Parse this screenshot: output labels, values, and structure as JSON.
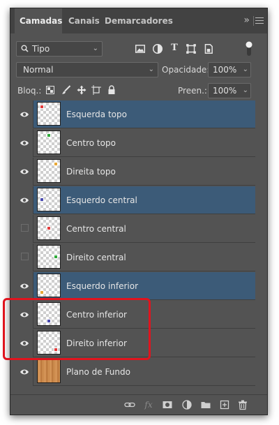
{
  "tabs": [
    {
      "label": "Camadas",
      "active": true
    },
    {
      "label": "Canais",
      "active": false
    },
    {
      "label": "Demarcadores",
      "active": false
    }
  ],
  "filter": {
    "value": "Tipo",
    "icon": "search-icon"
  },
  "filter_icons": [
    "image-filter-icon",
    "adjustment-filter-icon",
    "type-filter-icon",
    "shape-filter-icon",
    "smart-object-filter-icon"
  ],
  "blend": {
    "mode": "Normal",
    "opacity_label": "Opacidade:",
    "opacity": "100%"
  },
  "lock": {
    "label": "Bloq.:",
    "fill_label": "Preen.:",
    "fill": "100%"
  },
  "layers": [
    {
      "name": "Esquerda topo",
      "visible": true,
      "selected": true,
      "dot_color": "#e23a3a",
      "dot_pos": "tl"
    },
    {
      "name": "Centro topo",
      "visible": true,
      "selected": false,
      "dot_color": "#2faa3a",
      "dot_pos": "tc"
    },
    {
      "name": "Direita topo",
      "visible": true,
      "selected": false,
      "dot_color": "#e8a838",
      "dot_pos": "tr"
    },
    {
      "name": "Esquerdo central",
      "visible": true,
      "selected": true,
      "dot_color": "#4a4ab0",
      "dot_pos": "ml"
    },
    {
      "name": "Centro central",
      "visible": false,
      "selected": false,
      "dot_color": "#e23a3a",
      "dot_pos": "mc"
    },
    {
      "name": "Direito central",
      "visible": false,
      "selected": false,
      "dot_color": "#2faa3a",
      "dot_pos": "mr"
    },
    {
      "name": "Esquerdo inferior",
      "visible": true,
      "selected": true,
      "dot_color": "#e8a838",
      "dot_pos": "bl"
    },
    {
      "name": "Centro inferior",
      "visible": true,
      "selected": false,
      "dot_color": "#4a4ab0",
      "dot_pos": "bc"
    },
    {
      "name": "Direito inferior",
      "visible": true,
      "selected": false,
      "dot_color": "#e23a3a",
      "dot_pos": "br"
    },
    {
      "name": "Plano de Fundo",
      "visible": true,
      "selected": false,
      "dot_color": "",
      "dot_pos": "background"
    }
  ],
  "highlighted_layers": [
    "Centro inferior",
    "Direito inferior"
  ],
  "footer_icons": [
    "link-layers-icon",
    "fx-icon",
    "add-mask-icon",
    "adjustment-layer-icon",
    "group-folder-icon",
    "new-layer-icon",
    "trash-icon"
  ],
  "colors": {
    "selected": "#3c5b78",
    "panel": "#535353",
    "highlight": "#e0141e"
  }
}
